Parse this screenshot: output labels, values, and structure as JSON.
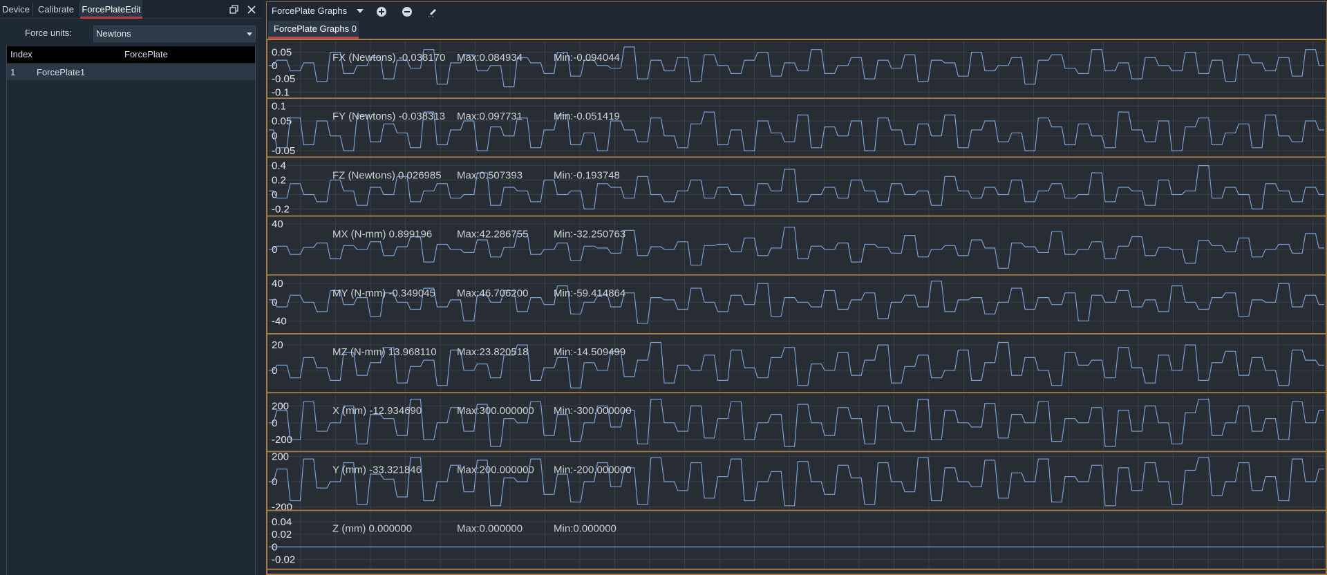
{
  "left_tabs": [
    {
      "label": "Device",
      "active": false
    },
    {
      "label": "Calibrate",
      "active": false
    },
    {
      "label": "ForcePlateEdit",
      "active": true
    }
  ],
  "force_units": {
    "label": "Force units:",
    "value": "Newtons"
  },
  "table": {
    "headers": [
      "Index",
      "ForcePlate"
    ],
    "rows": [
      [
        "1",
        "ForcePlate1"
      ]
    ]
  },
  "graphs_toolbar": {
    "title": "ForcePlate Graphs",
    "tab": "ForcePlate Graphs 0"
  },
  "colors": {
    "accent": "#c0404a",
    "frame": "#a67c46",
    "trace": "#7c9fd6",
    "plot_bg": "#282d34"
  },
  "chart_data": [
    {
      "type": "line",
      "title": "FX (Newtons) -0.038170",
      "max": "Max:0.084934",
      "min": "Min:-0.094044",
      "yticks": [
        "0.05",
        "0",
        "-0.05",
        "-0.1"
      ],
      "ytick_values": [
        0.05,
        0,
        -0.05,
        -0.1
      ],
      "ylim": [
        -0.11,
        0.08
      ],
      "series": [
        {
          "values": [
            0.0,
            0.02,
            -0.02,
            0.01,
            -0.06,
            0.05,
            -0.03,
            0.0,
            0.03,
            -0.05,
            0.02,
            -0.01,
            0.06,
            -0.07,
            0.01,
            0.04,
            -0.02,
            0.0,
            -0.08,
            0.03,
            0.01,
            -0.03,
            0.05,
            -0.04,
            0.02,
            0.0,
            -0.01,
            0.07,
            -0.05,
            0.02,
            -0.02,
            0.03,
            -0.06,
            0.04,
            0.0,
            -0.03,
            0.02,
            0.05,
            -0.04,
            0.01,
            -0.02,
            0.06,
            -0.03,
            0.0,
            0.03,
            -0.05,
            0.02,
            -0.01,
            0.04,
            -0.06,
            0.02,
            0.01,
            -0.04,
            0.05,
            -0.02,
            0.0,
            0.03,
            -0.07,
            0.02,
            0.04,
            -0.01,
            -0.03,
            0.06,
            -0.02,
            0.01,
            -0.05,
            0.03,
            0.0,
            -0.02,
            0.05,
            -0.03,
            0.02,
            -0.06,
            0.04,
            0.01,
            -0.02,
            0.03,
            -0.04,
            0.06,
            0.0
          ]
        }
      ]
    },
    {
      "type": "line",
      "title": "FY (Newtons) -0.038313",
      "max": "Max:0.097731",
      "min": "Min:-0.051419",
      "yticks": [
        "0.1",
        "0.05",
        "0",
        "-0.05"
      ],
      "ytick_values": [
        0.1,
        0.05,
        0,
        -0.05
      ],
      "ylim": [
        -0.06,
        0.11
      ],
      "series": [
        {
          "values": [
            0.02,
            -0.04,
            0.06,
            -0.03,
            0.05,
            0.0,
            -0.05,
            0.07,
            -0.02,
            0.04,
            0.01,
            -0.04,
            0.08,
            -0.03,
            0.02,
            0.05,
            -0.05,
            0.03,
            0.0,
            0.06,
            -0.04,
            0.02,
            0.07,
            -0.03,
            0.01,
            -0.05,
            0.05,
            0.02,
            -0.02,
            0.06,
            0.0,
            -0.04,
            0.04,
            0.08,
            -0.03,
            0.02,
            -0.05,
            0.05,
            0.01,
            -0.02,
            0.07,
            -0.04,
            0.03,
            0.0,
            0.05,
            -0.05,
            0.06,
            0.02,
            -0.03,
            0.04,
            0.0,
            0.07,
            -0.04,
            0.02,
            0.05,
            -0.02,
            0.01,
            -0.05,
            0.06,
            0.03,
            -0.03,
            0.04,
            0.0,
            -0.04,
            0.08,
            0.02,
            -0.02,
            0.05,
            -0.05,
            0.03,
            0.06,
            -0.03,
            0.01,
            0.04,
            -0.04,
            0.07,
            0.0,
            -0.02,
            0.05,
            0.02
          ]
        }
      ]
    },
    {
      "type": "line",
      "title": "FZ (Newtons) 0.026985",
      "max": "Max:0.507393",
      "min": "Min:-0.193748",
      "yticks": [
        "0.4",
        "0.2",
        "0",
        "-0.2"
      ],
      "ytick_values": [
        0.4,
        0.2,
        0,
        -0.2
      ],
      "ylim": [
        -0.25,
        0.45
      ],
      "series": [
        {
          "values": [
            0.05,
            -0.05,
            0.15,
            0.0,
            -0.1,
            0.2,
            0.05,
            -0.15,
            0.1,
            0.0,
            0.25,
            -0.1,
            0.05,
            0.15,
            -0.05,
            0.0,
            0.3,
            -0.15,
            0.1,
            0.05,
            -0.1,
            0.2,
            0.0,
            0.05,
            -0.2,
            0.15,
            0.1,
            -0.05,
            0.25,
            0.0,
            -0.1,
            0.05,
            0.2,
            -0.05,
            0.1,
            0.0,
            -0.15,
            0.15,
            0.05,
            0.35,
            -0.1,
            0.0,
            0.1,
            -0.05,
            0.2,
            0.05,
            -0.1,
            0.15,
            0.0,
            0.05,
            -0.15,
            0.25,
            0.05,
            -0.05,
            0.1,
            0.0,
            0.2,
            -0.1,
            0.05,
            0.15,
            -0.05,
            0.0,
            0.3,
            -0.1,
            0.1,
            0.05,
            -0.15,
            0.2,
            0.0,
            0.05,
            0.4,
            -0.05,
            0.1,
            0.0,
            -0.2,
            0.15,
            0.05,
            -0.1,
            0.1,
            0.0
          ]
        }
      ]
    },
    {
      "type": "line",
      "title": "MX (N-mm) 0.899196",
      "max": "Max:42.286755",
      "min": "Min:-32.250763",
      "yticks": [
        "40",
        "0"
      ],
      "ytick_values": [
        40,
        0
      ],
      "ylim": [
        -35,
        45
      ],
      "series": [
        {
          "values": [
            0,
            5,
            -8,
            3,
            10,
            -15,
            6,
            0,
            12,
            -10,
            4,
            20,
            -20,
            8,
            0,
            -5,
            15,
            -12,
            3,
            25,
            -8,
            0,
            10,
            -18,
            5,
            2,
            -6,
            30,
            -10,
            4,
            0,
            12,
            -25,
            6,
            8,
            -4,
            18,
            -10,
            2,
            35,
            -15,
            5,
            0,
            10,
            -20,
            8,
            3,
            -6,
            22,
            -12,
            0,
            6,
            -10,
            15,
            2,
            -30,
            10,
            4,
            -5,
            28,
            -8,
            0,
            12,
            -15,
            5,
            20,
            -10,
            3,
            0,
            -22,
            14,
            6,
            -4,
            18,
            -12,
            0,
            8,
            -6,
            25,
            2
          ]
        }
      ]
    },
    {
      "type": "line",
      "title": "MY (N-mm) -0.349045",
      "max": "Max:46.706200",
      "min": "Min:-59.414864",
      "yticks": [
        "40",
        "0",
        "-40"
      ],
      "ytick_values": [
        40,
        0,
        -40
      ],
      "ylim": [
        -60,
        48
      ],
      "series": [
        {
          "values": [
            5,
            -10,
            15,
            0,
            -20,
            25,
            -5,
            10,
            -30,
            20,
            0,
            -15,
            30,
            -10,
            5,
            -40,
            15,
            0,
            25,
            -20,
            10,
            -5,
            35,
            -25,
            0,
            15,
            -10,
            20,
            -45,
            10,
            5,
            -15,
            30,
            0,
            -20,
            15,
            -5,
            40,
            -30,
            10,
            0,
            -10,
            25,
            -15,
            5,
            20,
            -35,
            0,
            15,
            -10,
            45,
            -20,
            5,
            10,
            -25,
            0,
            30,
            -15,
            10,
            -5,
            20,
            -40,
            15,
            0,
            25,
            -10,
            5,
            -20,
            35,
            0,
            -15,
            10,
            20,
            -30,
            5,
            0,
            40,
            -10,
            15,
            -5
          ]
        }
      ]
    },
    {
      "type": "line",
      "title": "MZ (N-mm) 13.968110",
      "max": "Max:23.820518",
      "min": "Min:-14.509499",
      "yticks": [
        "20",
        "0"
      ],
      "ytick_values": [
        20,
        0
      ],
      "ylim": [
        -15,
        25
      ],
      "series": [
        {
          "values": [
            0,
            4,
            -6,
            10,
            2,
            -8,
            14,
            -4,
            6,
            18,
            -10,
            3,
            8,
            -12,
            16,
            0,
            5,
            -6,
            12,
            20,
            -8,
            2,
            10,
            -14,
            6,
            0,
            15,
            -5,
            8,
            22,
            -10,
            4,
            0,
            12,
            -8,
            16,
            2,
            -6,
            10,
            18,
            -12,
            5,
            0,
            14,
            -4,
            8,
            20,
            -10,
            3,
            12,
            -6,
            0,
            16,
            -8,
            6,
            22,
            -4,
            10,
            0,
            -12,
            14,
            4,
            8,
            -6,
            18,
            2,
            -10,
            12,
            0,
            20,
            -8,
            6,
            15,
            -4,
            10,
            0,
            -12,
            16,
            8,
            4
          ]
        }
      ]
    },
    {
      "type": "line",
      "title": "X (mm) -12.934690",
      "max": "Max:300.000000",
      "min": "Min:-300.000000",
      "yticks": [
        "200",
        "0",
        "-200"
      ],
      "ytick_values": [
        200,
        0,
        -200
      ],
      "ylim": [
        -300,
        300
      ],
      "series": [
        {
          "values": [
            0,
            150,
            -200,
            250,
            -100,
            0,
            200,
            -250,
            100,
            50,
            -150,
            280,
            -200,
            0,
            180,
            -100,
            220,
            -280,
            50,
            0,
            250,
            -150,
            100,
            -220,
            0,
            200,
            -50,
            150,
            -250,
            280,
            0,
            -100,
            200,
            -180,
            50,
            250,
            -200,
            0,
            100,
            -280,
            220,
            0,
            -150,
            180,
            50,
            -250,
            200,
            0,
            -100,
            280,
            -200,
            150,
            0,
            -50,
            230,
            -180,
            100,
            0,
            250,
            -220,
            50,
            0,
            180,
            -280,
            150,
            -100,
            200,
            0,
            -250,
            120,
            280,
            -150,
            0,
            200,
            -100,
            50,
            -200,
            250,
            0,
            150
          ]
        }
      ]
    },
    {
      "type": "line",
      "title": "Y (mm) -33.321846",
      "max": "Max:200.000000",
      "min": "Min:-200.000000",
      "yticks": [
        "200",
        "0",
        "-200"
      ],
      "ytick_values": [
        200,
        0,
        -200
      ],
      "ylim": [
        -200,
        200
      ],
      "series": [
        {
          "values": [
            0,
            100,
            -150,
            180,
            -50,
            0,
            150,
            -180,
            60,
            20,
            -120,
            190,
            -150,
            0,
            130,
            -80,
            170,
            -190,
            30,
            0,
            180,
            -100,
            60,
            -160,
            0,
            150,
            -40,
            110,
            -180,
            190,
            0,
            -70,
            150,
            -130,
            40,
            180,
            -150,
            0,
            80,
            -190,
            160,
            0,
            -100,
            130,
            30,
            -180,
            150,
            0,
            -80,
            190,
            -150,
            110,
            0,
            -40,
            170,
            -130,
            70,
            0,
            180,
            -160,
            40,
            0,
            130,
            -190,
            110,
            -70,
            150,
            0,
            -180,
            90,
            190,
            -110,
            0,
            150,
            -70,
            40,
            -150,
            180,
            0,
            100
          ]
        }
      ]
    },
    {
      "type": "line",
      "title": "Z (mm) 0.000000",
      "max": "Max:0.000000",
      "min": "Min:0.000000",
      "yticks": [
        "0.04",
        "0.02",
        "0",
        "-0.02"
      ],
      "ytick_values": [
        0.04,
        0.02,
        0,
        -0.02
      ],
      "ylim": [
        -0.03,
        0.05
      ],
      "series": [
        {
          "values": [
            0,
            0
          ]
        }
      ]
    }
  ]
}
